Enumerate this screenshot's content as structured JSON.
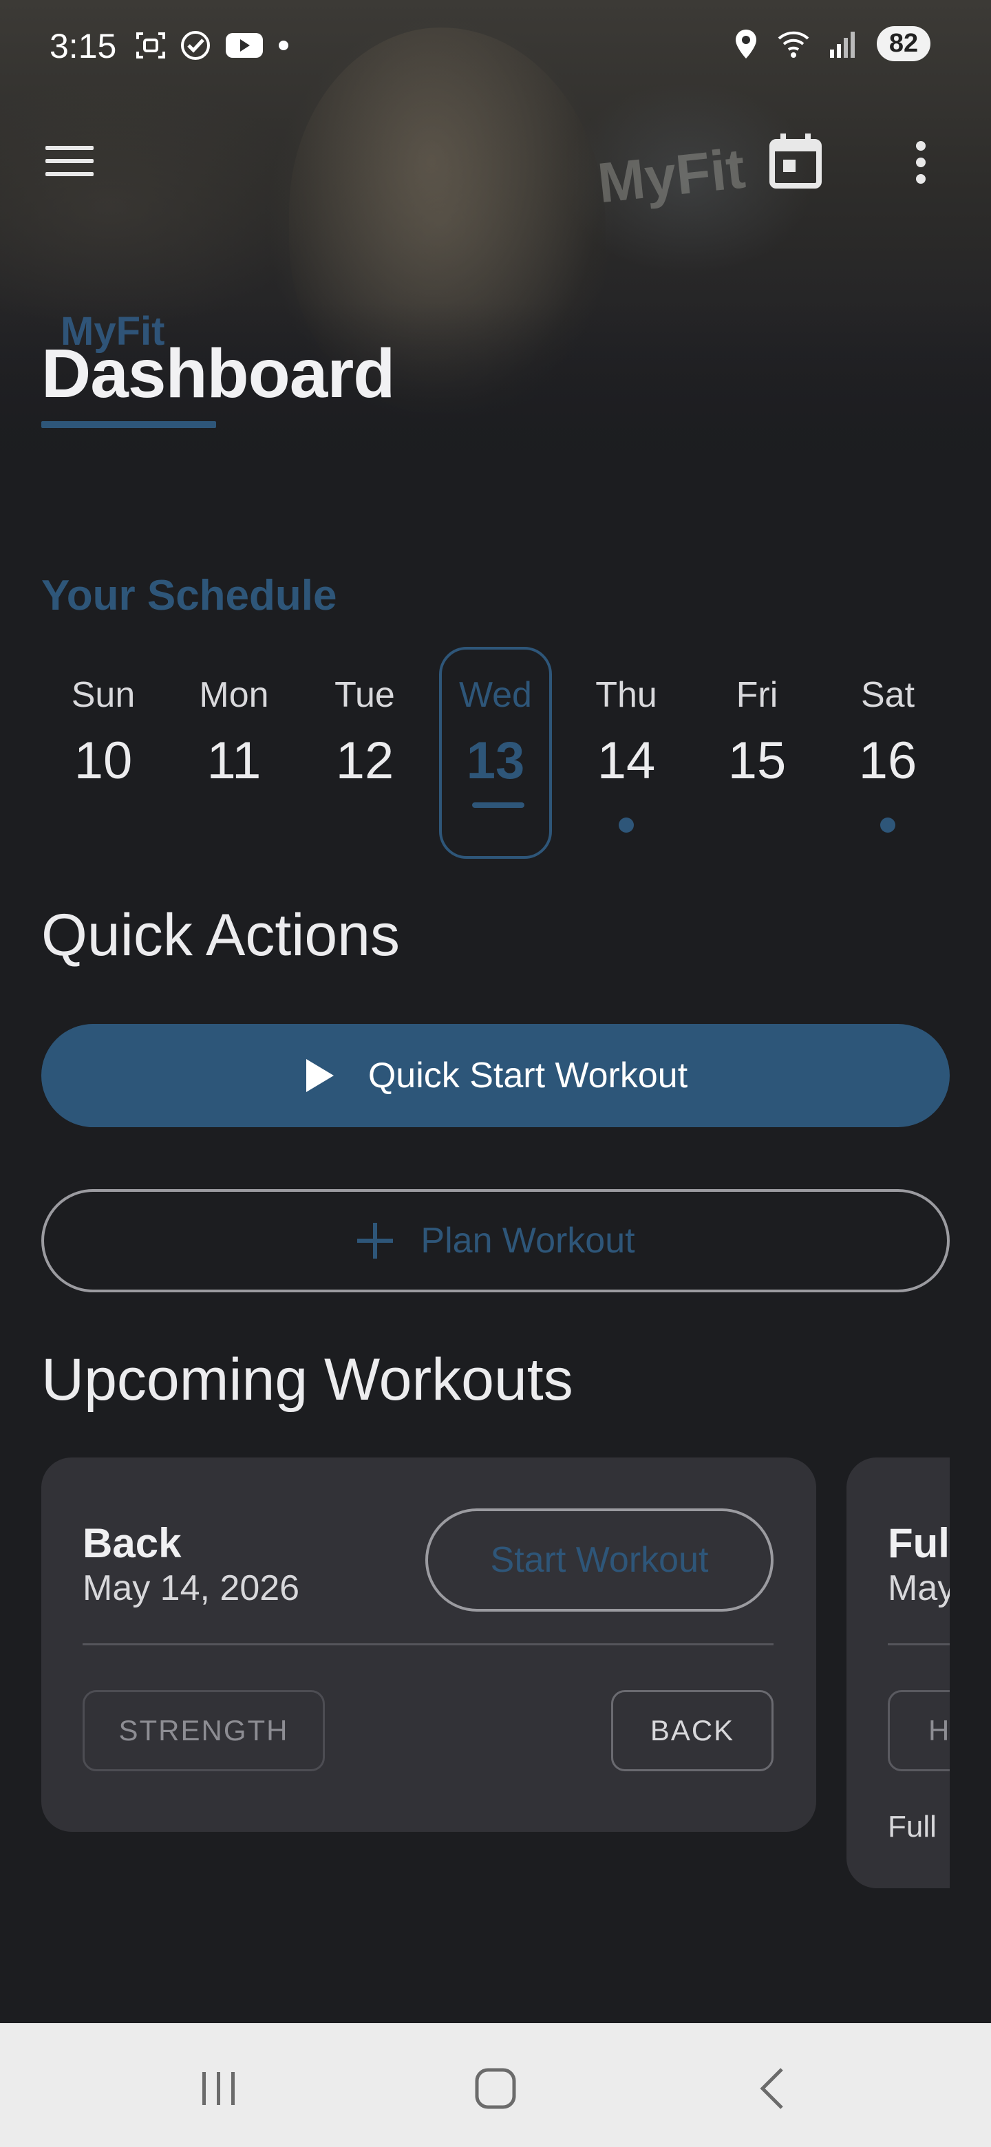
{
  "status_bar": {
    "time": "3:15",
    "battery": "82",
    "icons_left": [
      "screenshot-icon",
      "check-circle-icon",
      "youtube-icon",
      "dot-icon"
    ],
    "icons_right": [
      "location-icon",
      "wifi-icon",
      "signal-icon",
      "battery-icon"
    ]
  },
  "hero": {
    "sign_text": "MyFit"
  },
  "header": {
    "brand": "MyFit",
    "title": "Dashboard"
  },
  "schedule": {
    "heading": "Your Schedule",
    "days": [
      {
        "name": "Sun",
        "num": "10",
        "selected": false,
        "has_workout": false
      },
      {
        "name": "Mon",
        "num": "11",
        "selected": false,
        "has_workout": false
      },
      {
        "name": "Tue",
        "num": "12",
        "selected": false,
        "has_workout": false
      },
      {
        "name": "Wed",
        "num": "13",
        "selected": true,
        "has_workout": false
      },
      {
        "name": "Thu",
        "num": "14",
        "selected": false,
        "has_workout": true
      },
      {
        "name": "Fri",
        "num": "15",
        "selected": false,
        "has_workout": false
      },
      {
        "name": "Sat",
        "num": "16",
        "selected": false,
        "has_workout": true
      }
    ]
  },
  "quick_actions": {
    "heading": "Quick Actions",
    "quick_start_label": "Quick Start Workout",
    "plan_label": "Plan Workout"
  },
  "upcoming": {
    "heading": "Upcoming Workouts",
    "cards": [
      {
        "title": "Back",
        "date": "May 14, 2026",
        "start_label": "Start Workout",
        "chips": [
          "STRENGTH",
          "BACK"
        ]
      },
      {
        "title": "Full",
        "date": "May",
        "chips": [
          "H"
        ],
        "extra": "Full"
      }
    ]
  },
  "colors": {
    "accent": "#2e5679",
    "background": "#1c1d20",
    "card": "#323237",
    "nav_bar": "#ececec"
  }
}
